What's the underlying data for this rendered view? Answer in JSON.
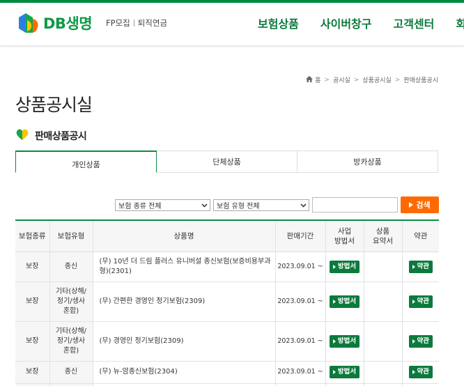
{
  "header": {
    "logo_text": "DB생명",
    "util": [
      "FP모집",
      "퇴직연금"
    ],
    "gnb": [
      "보험상품",
      "사이버창구",
      "고객센터",
      "회"
    ]
  },
  "breadcrumb": [
    "홈",
    "공시실",
    "상품공시실",
    "판매상품공시"
  ],
  "page_title": "상품공시실",
  "sub_title": "판매상품공시",
  "tabs": [
    {
      "label": "개인상품",
      "active": true
    },
    {
      "label": "단체상품",
      "active": false
    },
    {
      "label": "방카상품",
      "active": false
    }
  ],
  "search": {
    "select1": "보험 종류 전체",
    "select2": "보험 유형 전체",
    "input_value": "",
    "button": "검색"
  },
  "table": {
    "headers": [
      "보험종류",
      "보험유형",
      "상품명",
      "판매기간",
      "사업\n방법서",
      "상품\n요약서",
      "약관"
    ],
    "rows": [
      {
        "kind": "보장",
        "type": "종신",
        "name": "(무) 10년 더 드림 플러스 유니버설 종신보험(보증비용부과형)(2301)",
        "period": "2023.09.01 ~",
        "method": "방법서",
        "summary": "",
        "terms": "약관"
      },
      {
        "kind": "보장",
        "type": "기타(상해/\n정기/생사\n혼합)",
        "name": "(무) 간편한 경영인 정기보험(2309)",
        "period": "2023.09.01 ~",
        "method": "방법서",
        "summary": "",
        "terms": "약관"
      },
      {
        "kind": "보장",
        "type": "기타(상해/\n정기/생사\n혼합)",
        "name": "(무) 경영인 정기보험(2309)",
        "period": "2023.09.01 ~",
        "method": "방법서",
        "summary": "",
        "terms": "약관"
      },
      {
        "kind": "보장",
        "type": "종신",
        "name": "(무) 뉴-암종신보험(2304)",
        "period": "2023.09.01 ~",
        "method": "방법서",
        "summary": "",
        "terms": "약관"
      },
      {
        "kind": "",
        "type": "",
        "name": "",
        "period": "",
        "method": "",
        "summary": "",
        "terms": ""
      }
    ]
  },
  "colors": {
    "brand": "#0c8a45",
    "search_button": "#ff6a00",
    "nav_text": "#0a7a3a"
  }
}
